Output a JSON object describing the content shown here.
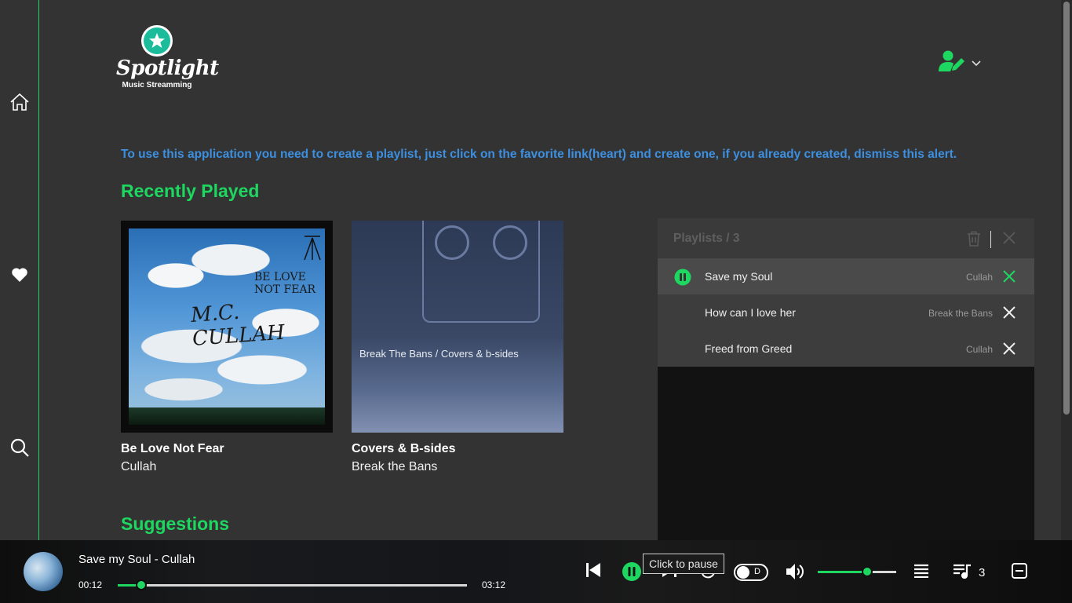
{
  "app": {
    "logo_name": "Spotlight",
    "logo_sub": "Music Streamming",
    "accent": "#1ed760",
    "alert_color": "#3d8fe0"
  },
  "sidebar": {
    "items": [
      {
        "icon": "home-icon"
      },
      {
        "icon": "heart-icon"
      },
      {
        "icon": "search-icon"
      }
    ]
  },
  "header": {
    "user_icon": "user-edit-icon",
    "menu_icon": "chevron-down-icon"
  },
  "alert": {
    "text": "To use this application you need to create a playlist, just click on the favorite link(heart) and create one, if you already created, dismiss this alert."
  },
  "recently_played": {
    "title": "Recently Played",
    "cards": [
      {
        "title": "Be Love Not Fear",
        "artist": "Cullah",
        "art_line1": "BE LOVE",
        "art_line2": "NOT FEAR",
        "art_logo": "M.C. CULLAH"
      },
      {
        "title": "Covers & B-sides",
        "artist": "Break the Bans",
        "art_text": "Break The Bans / Covers & b-sides"
      }
    ]
  },
  "suggestions": {
    "title": "Suggestions"
  },
  "playlist_panel": {
    "title": "Playlists / 3",
    "rows": [
      {
        "song": "Save my Soul",
        "artist": "Cullah",
        "active": true
      },
      {
        "song": "How can I love her",
        "artist": "Break the Bans",
        "active": false
      },
      {
        "song": "Freed from Greed",
        "artist": "Cullah",
        "active": false
      }
    ]
  },
  "player": {
    "now_playing": "Save my Soul - Cullah",
    "current_time": "00:12",
    "total_time": "03:12",
    "progress": 0.067,
    "tooltip": "Click to pause",
    "toggle_label": "D",
    "volume": 0.63,
    "queue_count": "3"
  }
}
